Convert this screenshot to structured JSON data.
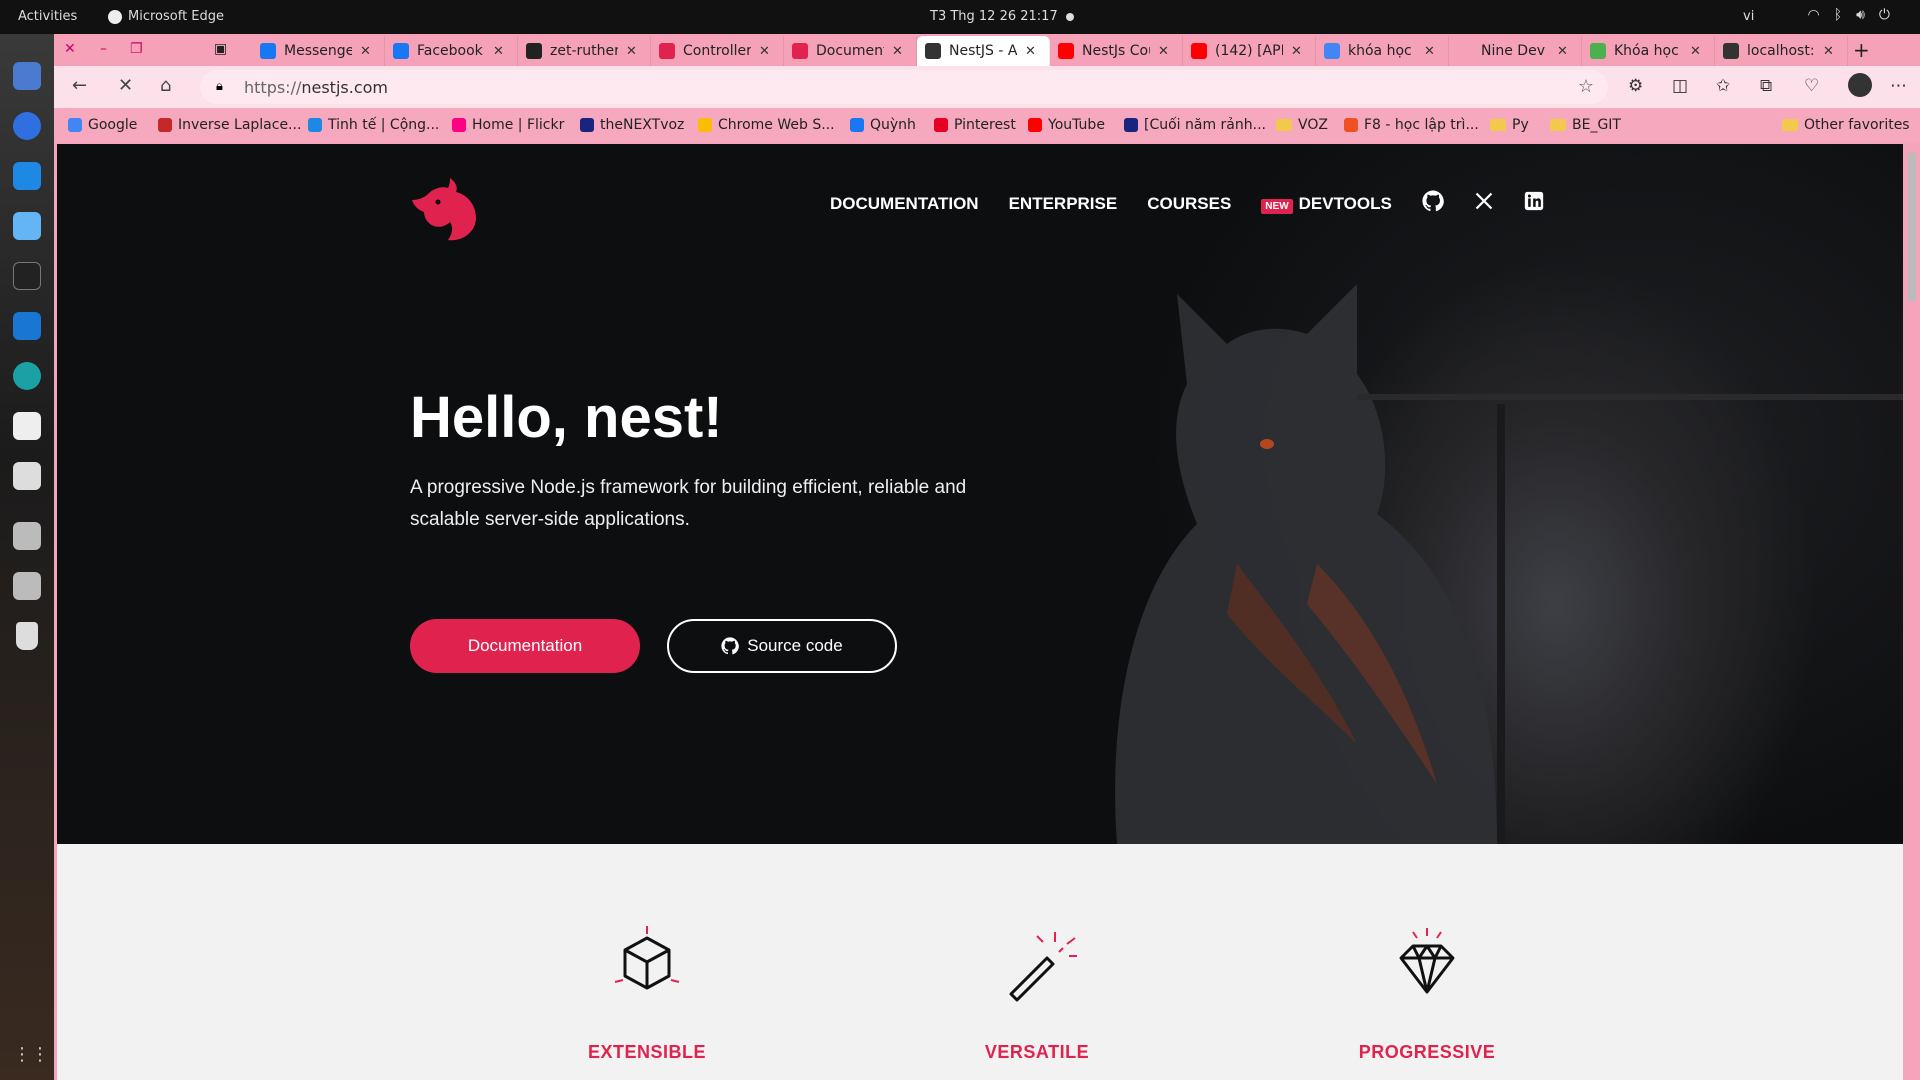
{
  "system": {
    "activities": "Activities",
    "app_name": "Microsoft Edge",
    "clock": "T3 Thg 12 26  21:17",
    "lang": "vi"
  },
  "tabs": [
    {
      "title": "Messenger",
      "color": "#1877f2"
    },
    {
      "title": "Facebook",
      "color": "#1877f2"
    },
    {
      "title": "zet-rutherford",
      "color": "#222222"
    },
    {
      "title": "Controllers",
      "color": "#e0234e"
    },
    {
      "title": "Documentation",
      "color": "#e0234e"
    },
    {
      "title": "NestJS - A",
      "color": "#333333",
      "active": true
    },
    {
      "title": "NestJs Course",
      "color": "#ff0000"
    },
    {
      "title": "(142) [API",
      "color": "#ff0000"
    },
    {
      "title": "khóa học",
      "color": "#4285f4"
    },
    {
      "title": "Nine Dev",
      "color": "#f5a2b9"
    },
    {
      "title": "Khóa học",
      "color": "#4caf50"
    },
    {
      "title": "localhost:",
      "color": "#333333"
    }
  ],
  "address": {
    "proto": "https://",
    "host": "nestjs.com"
  },
  "bookmarks": [
    {
      "label": "Google",
      "color": "#4285f4"
    },
    {
      "label": "Inverse Laplace...",
      "color": "#c62828"
    },
    {
      "label": "Tinh tế | Cộng...",
      "color": "#1e88e5"
    },
    {
      "label": "Home | Flickr",
      "color": "#ff0084"
    },
    {
      "label": "theNEXTvoz",
      "color": "#1a237e"
    },
    {
      "label": "Chrome Web S...",
      "color": "#fbbc05"
    },
    {
      "label": "Quỳnh",
      "color": "#1877f2"
    },
    {
      "label": "Pinterest",
      "color": "#e60023"
    },
    {
      "label": "YouTube",
      "color": "#ff0000"
    },
    {
      "label": "[Cuối năm rảnh...",
      "color": "#1a237e"
    },
    {
      "label": "VOZ",
      "folder": true
    },
    {
      "label": "F8 - học lập trì...",
      "color": "#f05123"
    },
    {
      "label": "Py",
      "folder": true
    },
    {
      "label": "BE_GIT",
      "folder": true
    }
  ],
  "other_favorites": "Other favorites",
  "nav": {
    "documentation": "DOCUMENTATION",
    "enterprise": "ENTERPRISE",
    "courses": "COURSES",
    "new_badge": "NEW",
    "devtools": "DEVTOOLS"
  },
  "hero": {
    "title": "Hello, nest!",
    "subtitle": "A progressive Node.js framework for building efficient, reliable and scalable server-side applications.",
    "btn_documentation": "Documentation",
    "btn_source": "Source code"
  },
  "features": [
    {
      "title": "EXTENSIBLE",
      "icon": "cube-icon"
    },
    {
      "title": "VERSATILE",
      "icon": "magic-wand-icon"
    },
    {
      "title": "PROGRESSIVE",
      "icon": "diamond-icon"
    }
  ],
  "colors": {
    "accent": "#e0234e",
    "browser_theme": "#f5a2b9"
  }
}
